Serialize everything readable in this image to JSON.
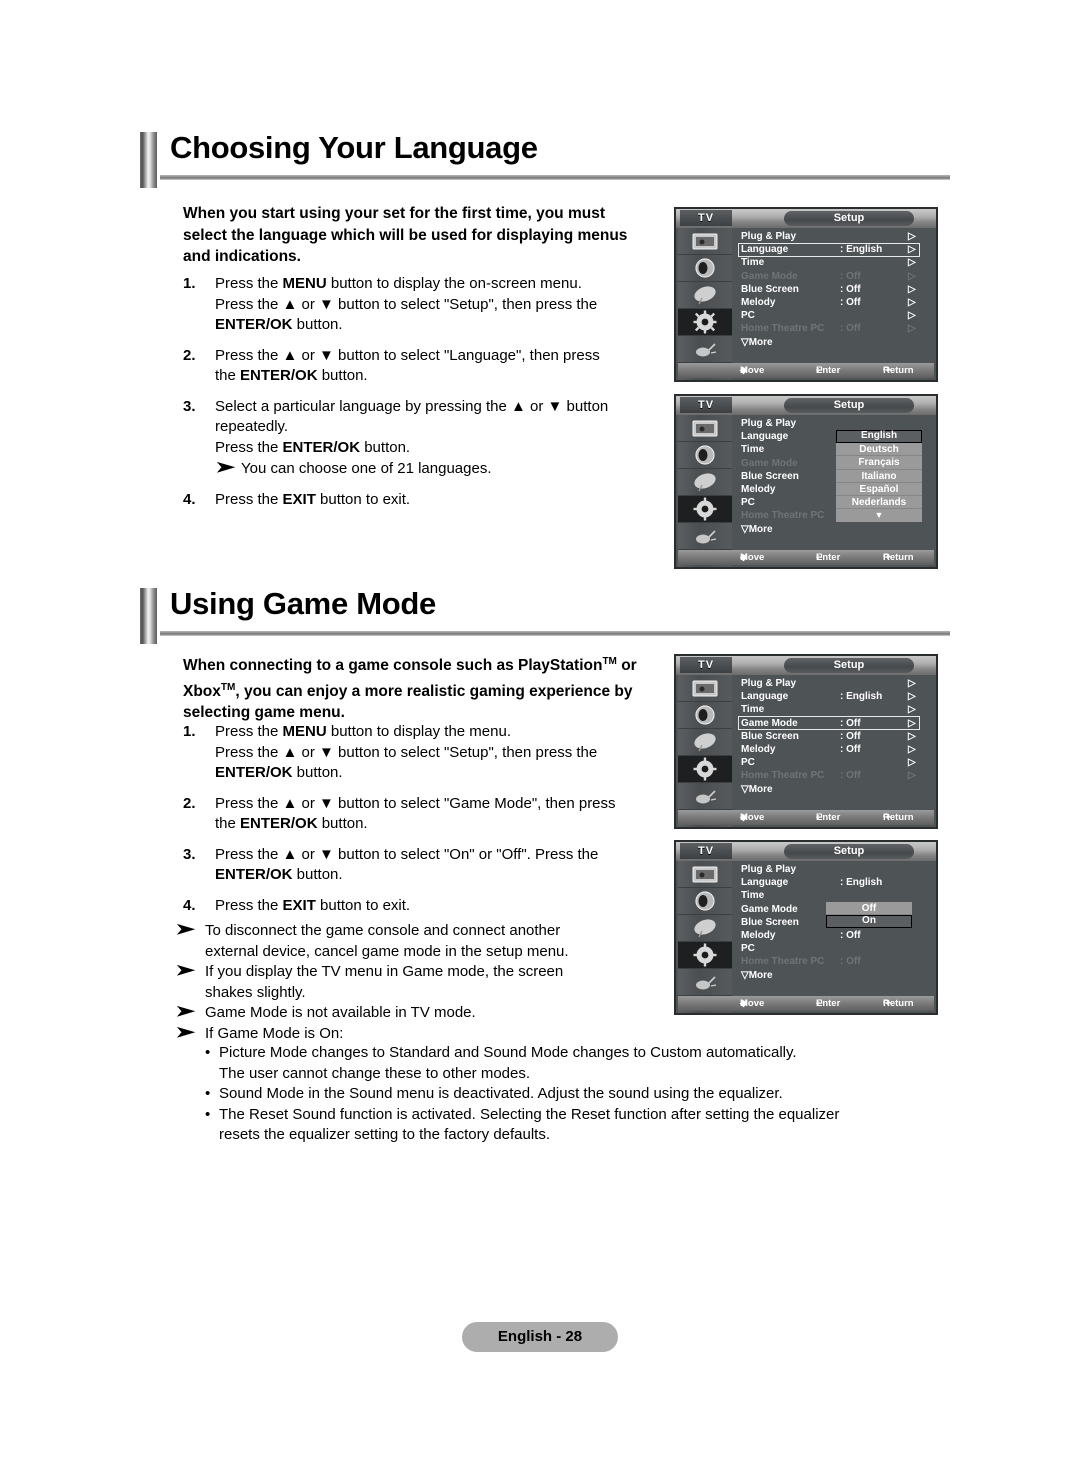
{
  "sections": [
    {
      "id": "choosing-language",
      "title": "Choosing Your Language",
      "intro": "When you start using your set for the first time, you must select the language which will be used for displaying menus and indications.",
      "steps": [
        {
          "num": "1.",
          "text": "Press the MENU button to display the on-screen menu. Press the ▲ or ▼ button to select \"Setup\", then press the ENTER/OK button."
        },
        {
          "num": "2.",
          "text": "Press the ▲ or ▼ button to select \"Language\", then press the ENTER/OK button."
        },
        {
          "num": "3.",
          "text": "Select a particular language by pressing the ▲ or ▼ button repeatedly. Press the ENTER/OK button."
        },
        {
          "num": "3note",
          "text": "You can choose one of 21 languages."
        },
        {
          "num": "4.",
          "text": "Press the EXIT button to exit."
        }
      ]
    },
    {
      "id": "using-game-mode",
      "title": "Using Game Mode",
      "intro": "When connecting to a game console such as PlayStation™ or Xbox™, you can enjoy a more realistic gaming experience by selecting game menu.",
      "steps": [
        {
          "num": "1.",
          "text": "Press the MENU button to display the menu. Press the ▲ or ▼ button to select \"Setup\", then press the ENTER/OK button."
        },
        {
          "num": "2.",
          "text": "Press the ▲ or ▼ button to select \"Game Mode\", then press the ENTER/OK button."
        },
        {
          "num": "3.",
          "text": "Press the ▲ or ▼ button to select \"On\" or \"Off\". Press the ENTER/OK button."
        },
        {
          "num": "4.",
          "text": "Press the EXIT button to exit."
        }
      ],
      "notes": [
        "To disconnect the game console and connect another external device, cancel game mode in the setup menu.",
        "If you display the TV menu in Game mode, the screen shakes slightly.",
        "Game Mode is not available in TV mode.",
        "If Game Mode is On:"
      ],
      "bullets": [
        "Picture Mode changes to Standard and Sound Mode changes to Custom automatically. The user cannot change these to other modes.",
        "Sound Mode in the Sound menu is deactivated. Adjust the sound using the equalizer.",
        "The Reset Sound function is activated. Selecting the Reset function after setting the equalizer resets the equalizer setting to the factory defaults."
      ]
    }
  ],
  "step_text": {
    "lang_1_a": "Press the ",
    "lang_1_menu": "MENU",
    "lang_1_b": " button to display the on-screen menu.",
    "lang_1_c": "Press the ▲ or ▼ button to select \"Setup\", then press the",
    "lang_1_enter": "ENTER/OK",
    "lang_1_d": " button.",
    "lang_2_a": "Press the ▲ or ▼ button to select \"Language\", then press",
    "lang_2_b": "the ",
    "lang_2_c": " button.",
    "lang_3_a": "Select a particular language by pressing the ▲ or ▼ button",
    "lang_3_b": "repeatedly.",
    "lang_3_c": "Press the ",
    "lang_3_d": " button.",
    "lang_3_note": "You can choose one of 21 languages.",
    "lang_4_a": "Press the ",
    "lang_4_exit": "EXIT",
    "lang_4_b": " button to exit.",
    "game_1_b": " button to display the menu.",
    "game_2_a": "Press the ▲ or ▼ button to select \"Game Mode\", then press",
    "game_3_a": "Press the ▲ or ▼ button to select \"On\" or \"Off\". Press the",
    "game_3_b": " button."
  },
  "intro_lines": {
    "lang_l1": "When you start using your set for the first time, you must",
    "lang_l2": "select the language which will be used for displaying menus",
    "lang_l3": "and indications.",
    "game_l1_a": "When connecting to a game console such as PlayStation",
    "game_l1_tm": "TM",
    "game_l1_b": " or",
    "game_l2_a": "Xbox",
    "game_l2_tm": "TM",
    "game_l2_b": ", you can enjoy a more realistic gaming experience by",
    "game_l3": "selecting game menu."
  },
  "note_lines": {
    "n1_a": "To disconnect the game console and connect another",
    "n1_b": "external device, cancel game mode in the setup menu.",
    "n2_a": "If you display the TV menu in Game mode, the screen",
    "n2_b": "shakes slightly.",
    "n3": "Game Mode is not available in TV mode.",
    "n4": "If Game Mode is On:",
    "b1_a": "Picture Mode changes to Standard and Sound Mode changes to Custom automatically.",
    "b1_b": "The user cannot change these to other modes.",
    "b2": "Sound Mode in the Sound menu is deactivated. Adjust the sound using the equalizer.",
    "b3_a": "The Reset Sound function is activated. Selecting the Reset function after setting the equalizer",
    "b3_b": "resets the equalizer setting to the factory defaults."
  },
  "osd": {
    "tv_label": "TV",
    "title": "Setup",
    "bottom": {
      "move": "Move",
      "enter": "Enter",
      "return": "Return"
    },
    "more_label": "More",
    "rows_base": [
      {
        "label": "Plug & Play",
        "value": "",
        "dim": false
      },
      {
        "label": "Language",
        "value": ": English",
        "dim": false
      },
      {
        "label": "Time",
        "value": "",
        "dim": false
      },
      {
        "label": "Game Mode",
        "value": ": Off",
        "dim": true
      },
      {
        "label": "Blue Screen",
        "value": ": Off",
        "dim": false
      },
      {
        "label": "Melody",
        "value": ": Off",
        "dim": false
      },
      {
        "label": "PC",
        "value": "",
        "dim": false
      },
      {
        "label": "Home Theatre PC",
        "value": ": Off",
        "dim": true
      }
    ],
    "menu1": {
      "selected_row": 1
    },
    "menu2": {
      "language_options": [
        "English",
        "Deutsch",
        "Français",
        "Italiano",
        "Español",
        "Nederlands"
      ],
      "selected_language": "English",
      "more_glyph": "▼"
    },
    "menu3": {
      "selected_row": 3,
      "game_mode_dim": false
    },
    "menu4": {
      "game_options": [
        "Off",
        "On"
      ],
      "selected_game": "On"
    },
    "icons": [
      "picture-icon",
      "sound-icon",
      "channel-icon",
      "setup-gear-icon",
      "input-icon"
    ]
  },
  "footer": {
    "page_label": "English - 28"
  }
}
